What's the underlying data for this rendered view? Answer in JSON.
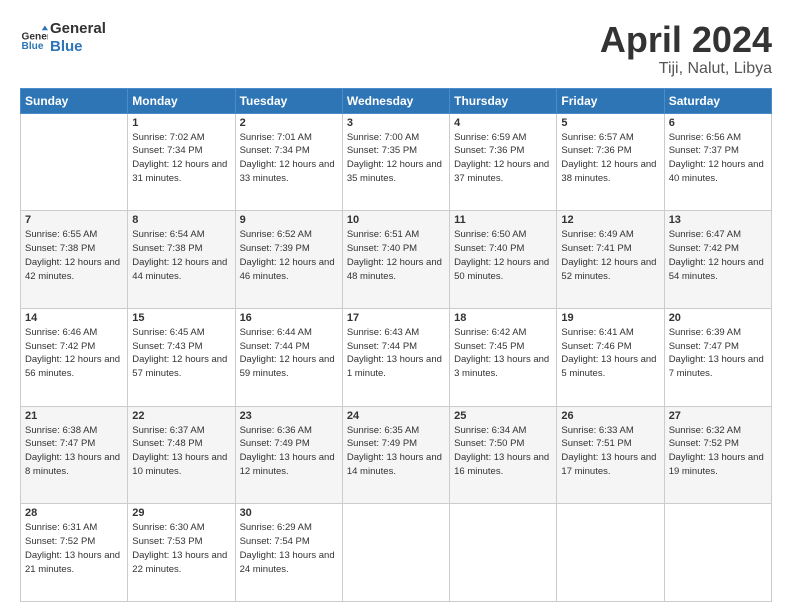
{
  "header": {
    "logo_line1": "General",
    "logo_line2": "Blue",
    "title": "April 2024",
    "subtitle": "Tiji, Nalut, Libya"
  },
  "columns": [
    "Sunday",
    "Monday",
    "Tuesday",
    "Wednesday",
    "Thursday",
    "Friday",
    "Saturday"
  ],
  "weeks": [
    [
      {
        "day": "",
        "sunrise": "",
        "sunset": "",
        "daylight": ""
      },
      {
        "day": "1",
        "sunrise": "7:02 AM",
        "sunset": "7:34 PM",
        "daylight": "12 hours and 31 minutes."
      },
      {
        "day": "2",
        "sunrise": "7:01 AM",
        "sunset": "7:34 PM",
        "daylight": "12 hours and 33 minutes."
      },
      {
        "day": "3",
        "sunrise": "7:00 AM",
        "sunset": "7:35 PM",
        "daylight": "12 hours and 35 minutes."
      },
      {
        "day": "4",
        "sunrise": "6:59 AM",
        "sunset": "7:36 PM",
        "daylight": "12 hours and 37 minutes."
      },
      {
        "day": "5",
        "sunrise": "6:57 AM",
        "sunset": "7:36 PM",
        "daylight": "12 hours and 38 minutes."
      },
      {
        "day": "6",
        "sunrise": "6:56 AM",
        "sunset": "7:37 PM",
        "daylight": "12 hours and 40 minutes."
      }
    ],
    [
      {
        "day": "7",
        "sunrise": "6:55 AM",
        "sunset": "7:38 PM",
        "daylight": "12 hours and 42 minutes."
      },
      {
        "day": "8",
        "sunrise": "6:54 AM",
        "sunset": "7:38 PM",
        "daylight": "12 hours and 44 minutes."
      },
      {
        "day": "9",
        "sunrise": "6:52 AM",
        "sunset": "7:39 PM",
        "daylight": "12 hours and 46 minutes."
      },
      {
        "day": "10",
        "sunrise": "6:51 AM",
        "sunset": "7:40 PM",
        "daylight": "12 hours and 48 minutes."
      },
      {
        "day": "11",
        "sunrise": "6:50 AM",
        "sunset": "7:40 PM",
        "daylight": "12 hours and 50 minutes."
      },
      {
        "day": "12",
        "sunrise": "6:49 AM",
        "sunset": "7:41 PM",
        "daylight": "12 hours and 52 minutes."
      },
      {
        "day": "13",
        "sunrise": "6:47 AM",
        "sunset": "7:42 PM",
        "daylight": "12 hours and 54 minutes."
      }
    ],
    [
      {
        "day": "14",
        "sunrise": "6:46 AM",
        "sunset": "7:42 PM",
        "daylight": "12 hours and 56 minutes."
      },
      {
        "day": "15",
        "sunrise": "6:45 AM",
        "sunset": "7:43 PM",
        "daylight": "12 hours and 57 minutes."
      },
      {
        "day": "16",
        "sunrise": "6:44 AM",
        "sunset": "7:44 PM",
        "daylight": "12 hours and 59 minutes."
      },
      {
        "day": "17",
        "sunrise": "6:43 AM",
        "sunset": "7:44 PM",
        "daylight": "13 hours and 1 minute."
      },
      {
        "day": "18",
        "sunrise": "6:42 AM",
        "sunset": "7:45 PM",
        "daylight": "13 hours and 3 minutes."
      },
      {
        "day": "19",
        "sunrise": "6:41 AM",
        "sunset": "7:46 PM",
        "daylight": "13 hours and 5 minutes."
      },
      {
        "day": "20",
        "sunrise": "6:39 AM",
        "sunset": "7:47 PM",
        "daylight": "13 hours and 7 minutes."
      }
    ],
    [
      {
        "day": "21",
        "sunrise": "6:38 AM",
        "sunset": "7:47 PM",
        "daylight": "13 hours and 8 minutes."
      },
      {
        "day": "22",
        "sunrise": "6:37 AM",
        "sunset": "7:48 PM",
        "daylight": "13 hours and 10 minutes."
      },
      {
        "day": "23",
        "sunrise": "6:36 AM",
        "sunset": "7:49 PM",
        "daylight": "13 hours and 12 minutes."
      },
      {
        "day": "24",
        "sunrise": "6:35 AM",
        "sunset": "7:49 PM",
        "daylight": "13 hours and 14 minutes."
      },
      {
        "day": "25",
        "sunrise": "6:34 AM",
        "sunset": "7:50 PM",
        "daylight": "13 hours and 16 minutes."
      },
      {
        "day": "26",
        "sunrise": "6:33 AM",
        "sunset": "7:51 PM",
        "daylight": "13 hours and 17 minutes."
      },
      {
        "day": "27",
        "sunrise": "6:32 AM",
        "sunset": "7:52 PM",
        "daylight": "13 hours and 19 minutes."
      }
    ],
    [
      {
        "day": "28",
        "sunrise": "6:31 AM",
        "sunset": "7:52 PM",
        "daylight": "13 hours and 21 minutes."
      },
      {
        "day": "29",
        "sunrise": "6:30 AM",
        "sunset": "7:53 PM",
        "daylight": "13 hours and 22 minutes."
      },
      {
        "day": "30",
        "sunrise": "6:29 AM",
        "sunset": "7:54 PM",
        "daylight": "13 hours and 24 minutes."
      },
      {
        "day": "",
        "sunrise": "",
        "sunset": "",
        "daylight": ""
      },
      {
        "day": "",
        "sunrise": "",
        "sunset": "",
        "daylight": ""
      },
      {
        "day": "",
        "sunrise": "",
        "sunset": "",
        "daylight": ""
      },
      {
        "day": "",
        "sunrise": "",
        "sunset": "",
        "daylight": ""
      }
    ]
  ],
  "labels": {
    "sunrise_prefix": "Sunrise: ",
    "sunset_prefix": "Sunset: ",
    "daylight_prefix": "Daylight: "
  }
}
